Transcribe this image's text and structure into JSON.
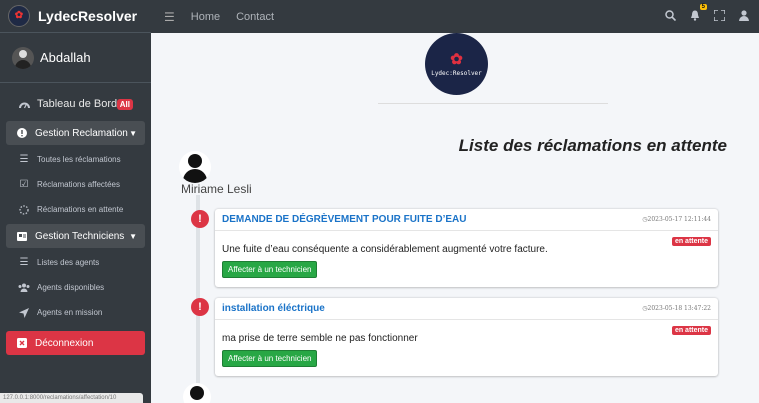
{
  "brand": {
    "name": "LydecResolver"
  },
  "user": {
    "name": "Abdallah"
  },
  "sidebar": {
    "items": [
      {
        "label": "Tableau de Bord",
        "badge": "All",
        "icon": "dashboard-icon"
      },
      {
        "label": "Gestion Reclamation",
        "icon": "exclamation-circle-icon",
        "group": true
      },
      {
        "label": "Toutes les réclamations",
        "icon": "list-icon"
      },
      {
        "label": "Réclamations affectées",
        "icon": "check-square-icon"
      },
      {
        "label": "Réclamations en attente",
        "icon": "spinner-icon"
      },
      {
        "label": "Gestion Techniciens",
        "icon": "id-card-icon",
        "group": true
      },
      {
        "label": "Listes des agents",
        "icon": "list-icon"
      },
      {
        "label": "Agents disponibles",
        "icon": "users-icon"
      },
      {
        "label": "Agents en mission",
        "icon": "location-arrow-icon"
      }
    ],
    "logout": "Déconnexion"
  },
  "status_url": "127.0.0.1:8000/reclamations/affectation/10",
  "topbar": {
    "links": [
      "Home",
      "Contact"
    ],
    "notification_count": "5"
  },
  "logo": {
    "word": "Lydec:Resolver"
  },
  "main": {
    "page_title": "Liste des réclamations en attente",
    "person": "Miriame Lesli",
    "cards": [
      {
        "title": "DEMANDE DE DÉGRÈVEMENT POUR FUITE D’EAU",
        "date": "2023-05-17 12:11:44",
        "text": "Une fuite d’eau conséquente a considérablement augmenté votre facture.",
        "status": "en attente",
        "button": "Affecter à un technicien"
      },
      {
        "title": "installation éléctrique",
        "date": "2023-05-18 13:47:22",
        "text": "ma prise de terre semble ne pas fonctionner",
        "status": "en attente",
        "button": "Affecter à un technicien"
      }
    ]
  },
  "colors": {
    "sidebar_bg": "#343a40",
    "danger": "#dc3545",
    "success": "#28a745",
    "link_blue": "#1a73c8"
  }
}
